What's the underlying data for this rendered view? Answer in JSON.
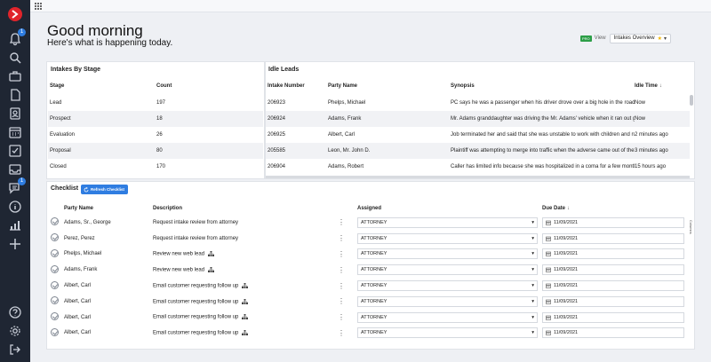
{
  "header": {
    "greeting": "Good morning",
    "subtitle": "Here's what is happening today.",
    "view_tag": "PRO",
    "view_label": "View",
    "view_selected": "Intakes Overview"
  },
  "rail": {
    "notification_count": "1",
    "message_count": "1",
    "icons": [
      "bell-icon",
      "search-icon",
      "briefcase-icon",
      "document-icon",
      "contact-icon",
      "calendar-icon",
      "task-icon",
      "inbox-icon",
      "messages-icon",
      "info-icon",
      "reports-icon",
      "add-icon",
      "help-icon",
      "settings-icon",
      "logout-icon"
    ]
  },
  "stages": {
    "title": "Intakes By Stage",
    "columns": [
      "Stage",
      "Count"
    ],
    "rows": [
      {
        "stage": "Lead",
        "count": "197"
      },
      {
        "stage": "Prospect",
        "count": "18"
      },
      {
        "stage": "Evaluation",
        "count": "26"
      },
      {
        "stage": "Proposal",
        "count": "80"
      },
      {
        "stage": "Closed",
        "count": "170"
      }
    ]
  },
  "idle": {
    "title": "Idle Leads",
    "columns": [
      "Intake Number",
      "Party Name",
      "Synopsis",
      "Idle Time"
    ],
    "rows": [
      {
        "num": "206923",
        "party": "Phelps, Michael",
        "synopsis": "PC says he was a passenger when his driver drove over a big hole in the road doing",
        "time": "Now"
      },
      {
        "num": "206924",
        "party": "Adams, Frank",
        "synopsis": "Mr. Adams granddaughter was driving the Mr. Adams' vehicle when it ran out gas o",
        "time": "Now"
      },
      {
        "num": "206925",
        "party": "Albert, Carl",
        "synopsis": "Job terminated her and said that she was unstable to work with children and neede",
        "time": "2 minutes ago"
      },
      {
        "num": "205585",
        "party": "Leon, Mr. John D.",
        "synopsis": "Plaintiff was attempting to merge into traffic when the adverse came out of the gas",
        "time": "3 minutes ago"
      },
      {
        "num": "206904",
        "party": "Adams, Robert",
        "synopsis": "Caller has limited info because she was hospitalized in a coma for a few months an",
        "time": "15 hours ago"
      }
    ]
  },
  "checklist": {
    "title": "Checklist",
    "refresh_label": "Refresh Checklist",
    "columns": [
      "Party Name",
      "Description",
      "Assigned",
      "Due Date"
    ],
    "columns_tab": "Columns",
    "rows": [
      {
        "party": "Adams, Sr., George",
        "desc": "Request intake review from attorney",
        "assigned": "ATTORNEY",
        "due": "11/09/2021",
        "org": false
      },
      {
        "party": "Perez, Perez",
        "desc": "Request intake review from attorney",
        "assigned": "ATTORNEY",
        "due": "11/09/2021",
        "org": false
      },
      {
        "party": "Phelps, Michael",
        "desc": "Review new web lead",
        "assigned": "ATTORNEY",
        "due": "11/09/2021",
        "org": true
      },
      {
        "party": "Adams, Frank",
        "desc": "Review new web lead",
        "assigned": "ATTORNEY",
        "due": "11/09/2021",
        "org": true
      },
      {
        "party": "Albert, Carl",
        "desc": "Email customer requesting follow up",
        "assigned": "ATTORNEY",
        "due": "11/09/2021",
        "org": true
      },
      {
        "party": "Albert, Carl",
        "desc": "Email customer requesting follow up",
        "assigned": "ATTORNEY",
        "due": "11/09/2021",
        "org": true
      },
      {
        "party": "Albert, Carl",
        "desc": "Email customer requesting follow up",
        "assigned": "ATTORNEY",
        "due": "11/09/2021",
        "org": true
      },
      {
        "party": "Albert, Carl",
        "desc": "Email customer requesting follow up",
        "assigned": "ATTORNEY",
        "due": "11/09/2021",
        "org": true
      }
    ]
  }
}
